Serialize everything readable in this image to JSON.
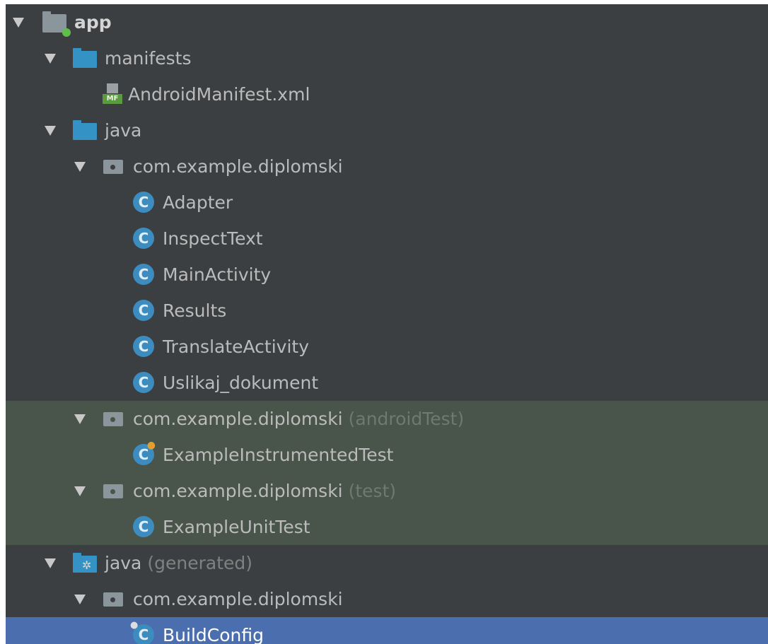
{
  "tree": {
    "app": {
      "label": "app",
      "icon": "app-module-folder-icon"
    },
    "manifests": {
      "label": "manifests",
      "icon": "folder-icon"
    },
    "android_manifest": {
      "label": "AndroidManifest.xml",
      "icon": "manifest-file-icon",
      "badge": "MF"
    },
    "java": {
      "label": "java",
      "icon": "folder-icon"
    },
    "pkg_main": {
      "label": "com.example.diplomski",
      "icon": "package-icon"
    },
    "classes_main": [
      {
        "label": "Adapter"
      },
      {
        "label": "InspectText"
      },
      {
        "label": "MainActivity"
      },
      {
        "label": "Results"
      },
      {
        "label": "TranslateActivity"
      },
      {
        "label": "Uslikaj_dokument"
      }
    ],
    "pkg_android_test": {
      "label": "com.example.diplomski",
      "suffix": "(androidTest)"
    },
    "class_instrumented": {
      "label": "ExampleInstrumentedTest"
    },
    "pkg_test": {
      "label": "com.example.diplomski",
      "suffix": "(test)"
    },
    "class_unit": {
      "label": "ExampleUnitTest"
    },
    "java_generated": {
      "label": "java",
      "suffix": "(generated)"
    },
    "pkg_generated": {
      "label": "com.example.diplomski"
    },
    "class_buildconfig": {
      "label": "BuildConfig"
    }
  },
  "class_icon_letter": "C",
  "colors": {
    "panel_bg": "#3c3f41",
    "test_bg": "#49544a",
    "selected_bg": "#4b6eaf",
    "folder_blue": "#3592c4",
    "class_icon": "#3c8cbf"
  }
}
